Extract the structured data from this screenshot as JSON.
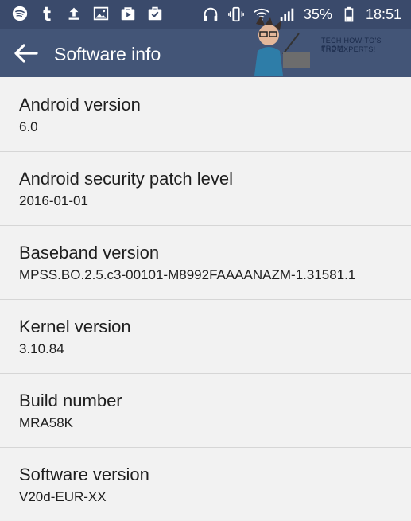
{
  "status_bar": {
    "left_icons": [
      "spotify-icon",
      "tumblr-icon",
      "upload-icon",
      "image-icon",
      "media-bag-icon",
      "briefcase-check-icon"
    ],
    "battery_percent": "35%",
    "time": "18:51"
  },
  "app_bar": {
    "title": "Software info"
  },
  "watermark": {
    "line1": "TECH HOW-TO'S FROM",
    "line2": "THE EXPERTS!"
  },
  "items": [
    {
      "label": "Android version",
      "value": "6.0"
    },
    {
      "label": "Android security patch level",
      "value": "2016-01-01"
    },
    {
      "label": "Baseband version",
      "value": "MPSS.BO.2.5.c3-00101-M8992FAAAANAZM-1.31581.1"
    },
    {
      "label": "Kernel version",
      "value": "3.10.84"
    },
    {
      "label": "Build number",
      "value": "MRA58K"
    },
    {
      "label": "Software version",
      "value": "V20d-EUR-XX"
    }
  ]
}
